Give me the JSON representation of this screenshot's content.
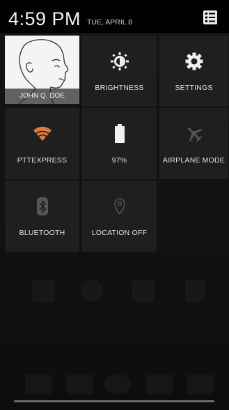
{
  "status": {
    "time": "4:59 PM",
    "date": "TUE, APRIL 8"
  },
  "user": {
    "name": "JOHN Q. DOE"
  },
  "tiles": [
    {
      "label": "BRIGHTNESS",
      "icon": "brightness-icon"
    },
    {
      "label": "SETTINGS",
      "icon": "gear-icon"
    },
    {
      "label": "PTTEXPRESS",
      "icon": "wifi-icon"
    },
    {
      "label": "97%",
      "icon": "battery-icon"
    },
    {
      "label": "AIRPLANE MODE",
      "icon": "airplane-icon"
    },
    {
      "label": "BLUETOOTH",
      "icon": "bluetooth-icon"
    },
    {
      "label": "LOCATION OFF",
      "icon": "location-icon"
    }
  ],
  "colors": {
    "tile_bg": "#1f1f1f",
    "wifi_accent": "#e07a3a",
    "disabled_icon": "#555555"
  }
}
